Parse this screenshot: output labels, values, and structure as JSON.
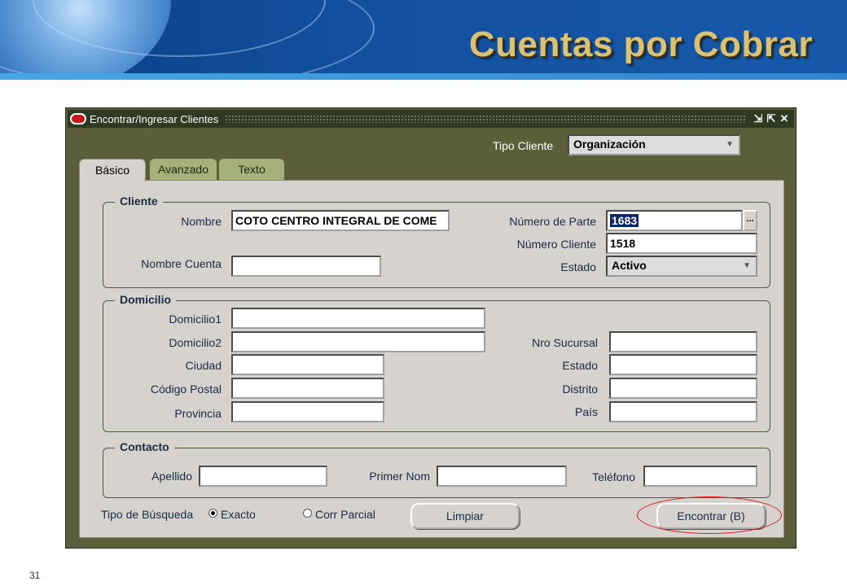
{
  "slide": {
    "title": "Cuentas por Cobrar",
    "page_number": "31"
  },
  "window": {
    "title": "Encontrar/Ingresar Clientes",
    "controls": [
      "⇲",
      "⇱",
      "✕"
    ]
  },
  "tipo_cliente": {
    "label": "Tipo Cliente",
    "value": "Organización"
  },
  "tabs": [
    {
      "label": "Básico",
      "active": true
    },
    {
      "label": "Avanzado",
      "active": false
    },
    {
      "label": "Texto",
      "active": false
    }
  ],
  "cliente": {
    "title": "Cliente",
    "nombre_label": "Nombre",
    "nombre_value": "COTO CENTRO INTEGRAL DE COME",
    "nombre_cuenta_label": "Nombre Cuenta",
    "nombre_cuenta_value": "",
    "numero_parte_label": "Número de Parte",
    "numero_parte_value": "1683",
    "lov_label": "...",
    "numero_cliente_label": "Número Cliente",
    "numero_cliente_value": "1518",
    "estado_label": "Estado",
    "estado_value": "Activo"
  },
  "domicilio": {
    "title": "Domicilio",
    "domicilio1_label": "Domicilio1",
    "domicilio2_label": "Domicilio2",
    "ciudad_label": "Ciudad",
    "codigo_postal_label": "Código Postal",
    "provincia_label": "Provincia",
    "nro_sucursal_label": "Nro Sucursal",
    "estado_label": "Estado",
    "distrito_label": "Distrito",
    "pais_label": "País"
  },
  "contacto": {
    "title": "Contacto",
    "apellido_label": "Apellido",
    "primer_nom_label": "Primer Nom",
    "telefono_label": "Teléfono"
  },
  "busqueda": {
    "label": "Tipo de Búsqueda",
    "exacto_label": "Exacto",
    "parcial_label": "Corr Parcial",
    "selected": "Exacto"
  },
  "buttons": {
    "limpiar": "Limpiar",
    "encontrar": "Encontrar (B)"
  },
  "colors": {
    "banner": "#134f9e",
    "title_gold": "#d8c27a",
    "window_olive": "#5a5f3a",
    "panel_grey": "#d6d3ce",
    "highlight_ring": "#dd1111"
  }
}
